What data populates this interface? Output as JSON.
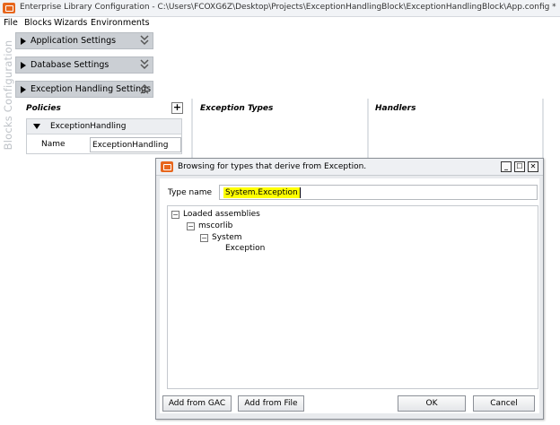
{
  "window": {
    "title": "Enterprise Library Configuration - C:\\Users\\FCOXG6Z\\Desktop\\Projects\\ExceptionHandlingBlock\\ExceptionHandlingBlock\\App.config *",
    "icon": "app-icon"
  },
  "menu": {
    "items": [
      {
        "label": "File"
      },
      {
        "label": "Blocks"
      },
      {
        "label": "Wizards"
      },
      {
        "label": "Environments"
      }
    ]
  },
  "sidebar": {
    "label": "Blocks Configuration"
  },
  "sections": [
    {
      "label": "Application Settings",
      "expanded": false
    },
    {
      "label": "Database Settings",
      "expanded": false
    },
    {
      "label": "Exception Handling Settings",
      "expanded": true
    }
  ],
  "exception_panel": {
    "columns": [
      {
        "title": "Policies"
      },
      {
        "title": "Exception Types"
      },
      {
        "title": "Handlers"
      }
    ],
    "policy": {
      "name": "ExceptionHandling",
      "name_field_label": "Name",
      "name_field_value": "ExceptionHandling"
    }
  },
  "dialog": {
    "title": "Browsing for types that derive from Exception.",
    "type_name_label": "Type name",
    "type_name_value": "System.Exception",
    "tree": [
      {
        "label": "Loaded assemblies",
        "expander": "⊟"
      },
      {
        "label": "mscorlib",
        "expander": "⊟"
      },
      {
        "label": "System",
        "expander": "⊟"
      },
      {
        "label": "Exception",
        "expander": ""
      }
    ],
    "buttons": {
      "add_from_gac": "Add from GAC",
      "add_from_file": "Add from File",
      "ok": "OK",
      "cancel": "Cancel"
    },
    "window_buttons": {
      "minimize": "_",
      "maximize": "☐",
      "close": "✕"
    }
  },
  "colors": {
    "accent": "#e7661c",
    "highlight": "#ffff00",
    "section_bar": "#cbcfd4"
  }
}
